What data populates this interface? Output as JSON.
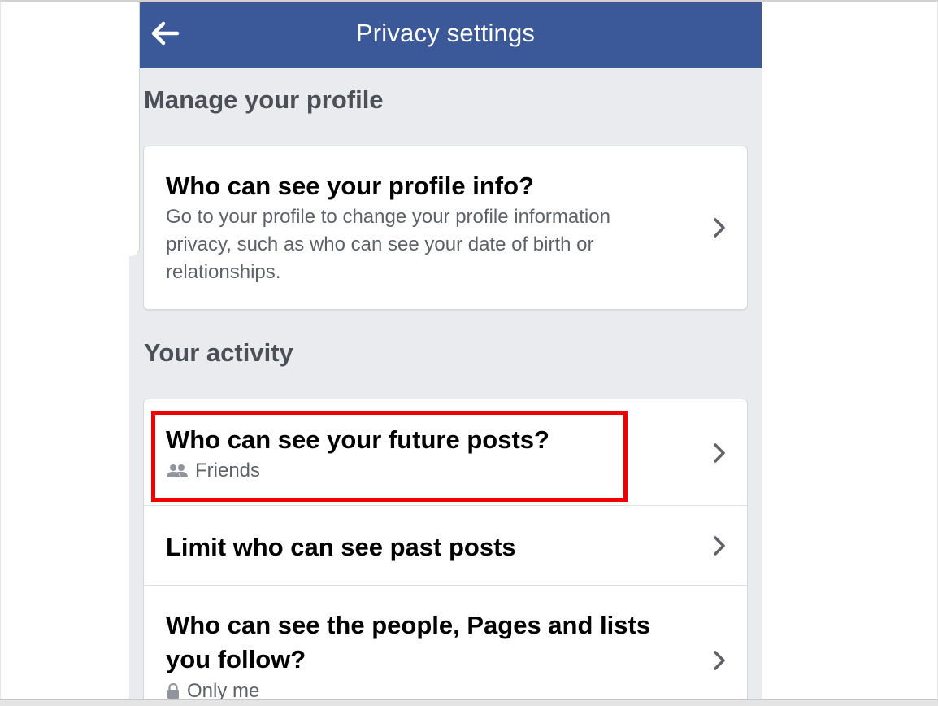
{
  "topbar": {
    "title": "Privacy settings",
    "back_icon": "arrow-left-icon",
    "background": "#3b5998"
  },
  "sections": {
    "profile": {
      "header": "Manage your profile",
      "item": {
        "title": "Who can see your profile info?",
        "description": "Go to your profile to change your profile information privacy, such as who can see your date of birth or relationships.",
        "chevron_icon": "chevron-right-icon"
      }
    },
    "activity": {
      "header": "Your activity",
      "items": [
        {
          "title": "Who can see your future posts?",
          "audience": "Friends",
          "audience_icon": "friends-icon",
          "chevron_icon": "chevron-right-icon",
          "highlighted": true
        },
        {
          "title": "Limit who can see past posts",
          "chevron_icon": "chevron-right-icon"
        },
        {
          "title": "Who can see the people, Pages and lists you follow?",
          "audience": "Only me",
          "audience_icon": "lock-icon",
          "chevron_icon": "chevron-right-icon"
        }
      ]
    }
  },
  "colors": {
    "highlight": "#ee0000",
    "page_background": "#e9ebee"
  }
}
